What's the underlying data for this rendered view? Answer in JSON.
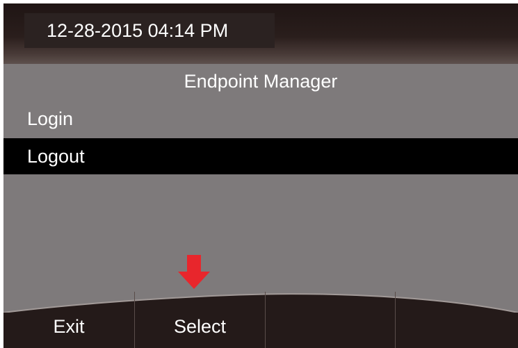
{
  "header": {
    "datetime": "12-28-2015 04:14 PM"
  },
  "screen": {
    "title": "Endpoint Manager"
  },
  "menu": {
    "items": [
      {
        "label": "Login",
        "selected": false
      },
      {
        "label": "Logout",
        "selected": true
      }
    ]
  },
  "softkeys": [
    {
      "label": "Exit"
    },
    {
      "label": "Select"
    },
    {
      "label": ""
    },
    {
      "label": ""
    }
  ],
  "annotation": {
    "arrow_icon": "down-arrow-icon",
    "arrow_color": "#e8262c"
  },
  "colors": {
    "screen_background": "#7e7a7b",
    "header_background": "#1f1514",
    "selected_row": "#000000",
    "softkey_background": "#241a19"
  }
}
